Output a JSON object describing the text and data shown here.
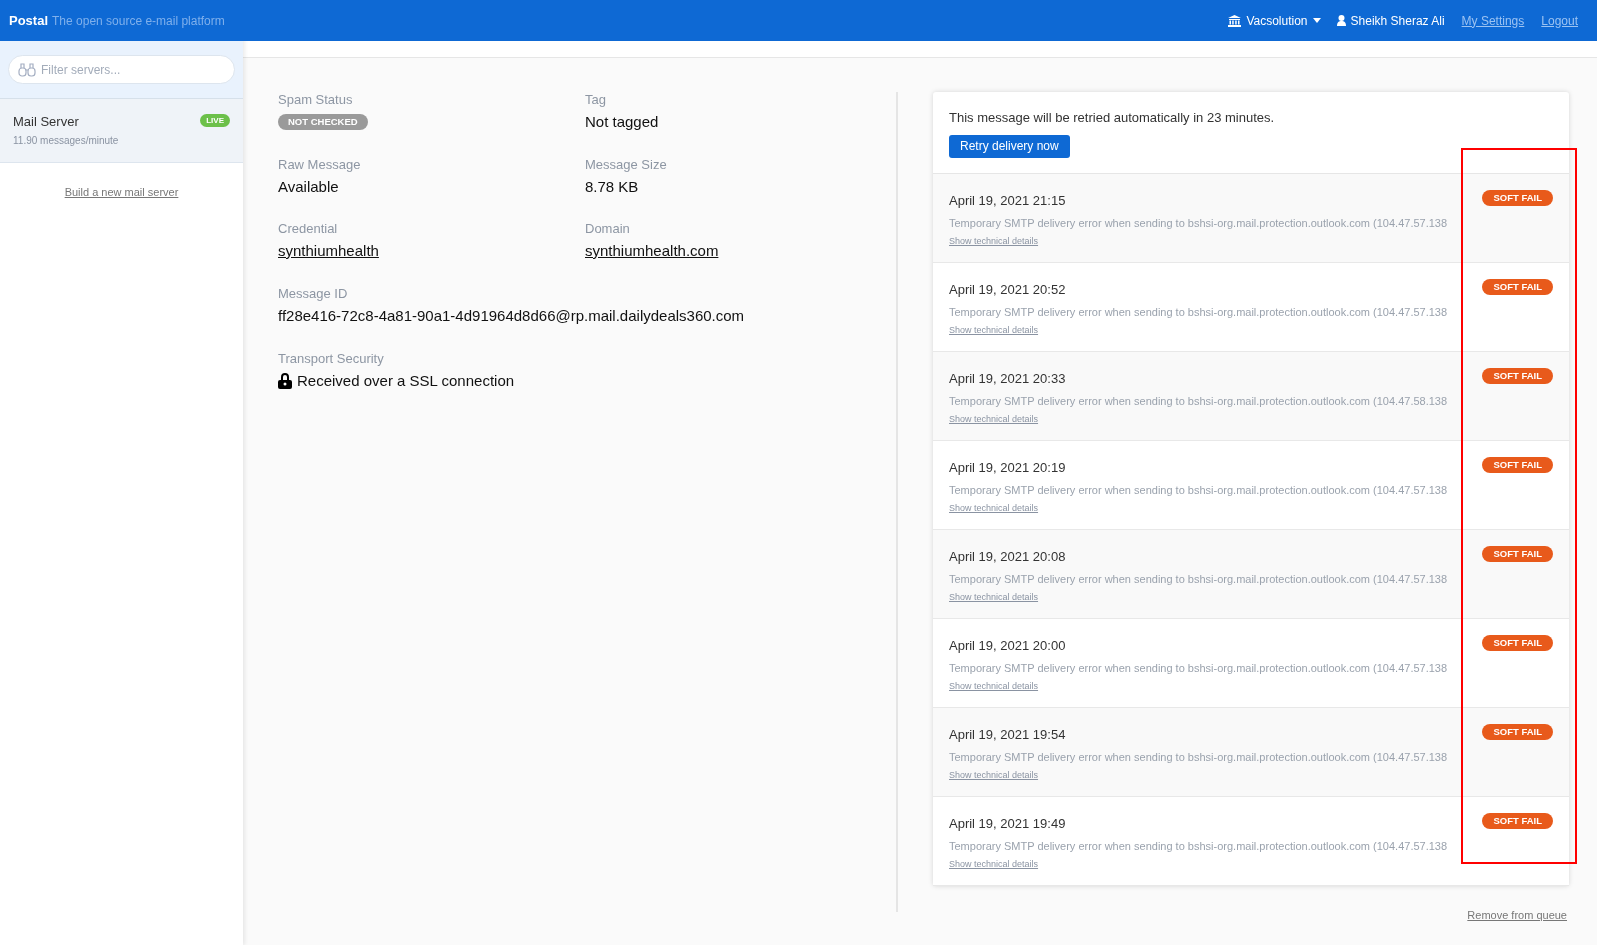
{
  "header": {
    "brand": "Postal",
    "tagline": "The open source e-mail platform",
    "organization": "Vacsolution",
    "user": "Sheikh Sheraz Ali",
    "links": [
      "My Settings",
      "Logout"
    ]
  },
  "sidebar": {
    "search": {
      "placeholder": "Filter servers..."
    },
    "servers": [
      {
        "name": "Mail Server",
        "rate": "11.90 messages/minute",
        "badge": "LIVE",
        "selected": true
      }
    ],
    "build_link": "Build a new mail server"
  },
  "properties": [
    {
      "label": "Spam Status",
      "value": "NOT CHECKED",
      "kind": "badge"
    },
    {
      "label": "Tag",
      "value": "Not tagged",
      "kind": "text"
    },
    {
      "label": "Raw Message",
      "value": "Available",
      "kind": "text"
    },
    {
      "label": "Message Size",
      "value": "8.78 KB",
      "kind": "text"
    },
    {
      "label": "Credential",
      "value": "synthiumhealth",
      "kind": "link"
    },
    {
      "label": "Domain",
      "value": "synthiumhealth.com",
      "kind": "link"
    },
    {
      "label": "Message ID",
      "value": "ff28e416-72c8-4a81-90a1-4d91964d8d66@rp.mail.dailydeals360.com",
      "kind": "wide"
    },
    {
      "label": "Transport Security",
      "value": "Received over a SSL connection",
      "kind": "secure"
    }
  ],
  "queue": {
    "notice": "This message will be retried automatically in 23 minutes.",
    "retry_button": "Retry delivery now",
    "attempts": [
      {
        "time": "April 19, 2021 21:15",
        "detail": "Temporary SMTP delivery error when sending to bshsi-org.mail.protection.outlook.com (104.47.57.138",
        "status": "SOFT FAIL",
        "link": "Show technical details"
      },
      {
        "time": "April 19, 2021 20:52",
        "detail": "Temporary SMTP delivery error when sending to bshsi-org.mail.protection.outlook.com (104.47.57.138",
        "status": "SOFT FAIL",
        "link": "Show technical details"
      },
      {
        "time": "April 19, 2021 20:33",
        "detail": "Temporary SMTP delivery error when sending to bshsi-org.mail.protection.outlook.com (104.47.58.138",
        "status": "SOFT FAIL",
        "link": "Show technical details"
      },
      {
        "time": "April 19, 2021 20:19",
        "detail": "Temporary SMTP delivery error when sending to bshsi-org.mail.protection.outlook.com (104.47.57.138",
        "status": "SOFT FAIL",
        "link": "Show technical details"
      },
      {
        "time": "April 19, 2021 20:08",
        "detail": "Temporary SMTP delivery error when sending to bshsi-org.mail.protection.outlook.com (104.47.57.138",
        "status": "SOFT FAIL",
        "link": "Show technical details"
      },
      {
        "time": "April 19, 2021 20:00",
        "detail": "Temporary SMTP delivery error when sending to bshsi-org.mail.protection.outlook.com (104.47.57.138",
        "status": "SOFT FAIL",
        "link": "Show technical details"
      },
      {
        "time": "April 19, 2021 19:54",
        "detail": "Temporary SMTP delivery error when sending to bshsi-org.mail.protection.outlook.com (104.47.57.138",
        "status": "SOFT FAIL",
        "link": "Show technical details"
      },
      {
        "time": "April 19, 2021 19:49",
        "detail": "Temporary SMTP delivery error when sending to bshsi-org.mail.protection.outlook.com (104.47.57.138",
        "status": "SOFT FAIL",
        "link": "Show technical details"
      }
    ],
    "remove_link": "Remove from queue"
  }
}
